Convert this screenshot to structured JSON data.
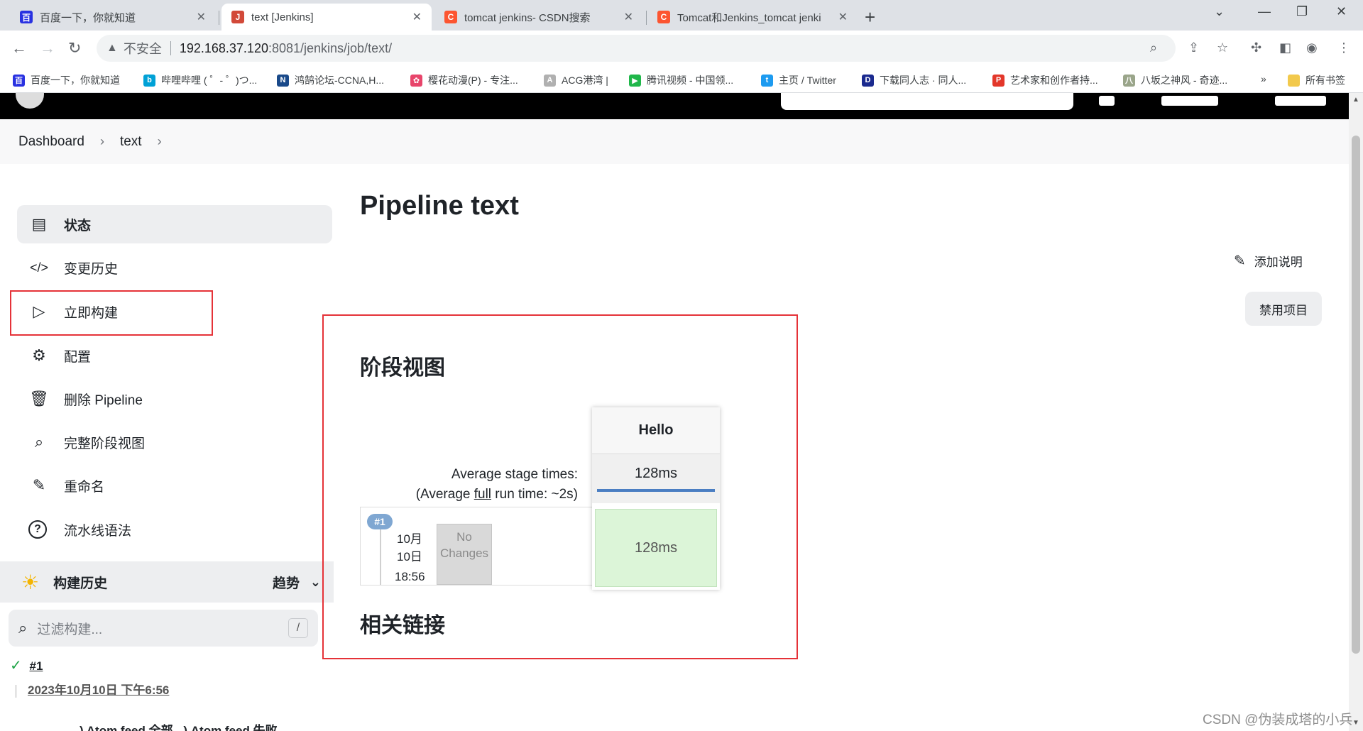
{
  "browser": {
    "tabs": [
      {
        "title": "百度一下，你就知道",
        "icon": "baidu-icon",
        "color": "#2932e1"
      },
      {
        "title": "text [Jenkins]",
        "icon": "jenkins-icon",
        "color": "#d24939"
      },
      {
        "title": "tomcat jenkins- CSDN搜索",
        "icon": "csdn-icon",
        "color": "#fc5531"
      },
      {
        "title": "Tomcat和Jenkins_tomcat jenki",
        "icon": "csdn-icon",
        "color": "#fc5531"
      }
    ],
    "url": {
      "insecure_label": "不安全",
      "host": "192.168.37.120",
      "path": ":8081/jenkins/job/text/"
    },
    "bookmarks": [
      {
        "label": "百度一下，你就知道",
        "icon": "baidu-icon",
        "color": "#2932e1"
      },
      {
        "label": "哔哩哔哩 ( ゜- ゜)つ...",
        "icon": "bilibili-icon",
        "color": "#00a1d6"
      },
      {
        "label": "鸿鹄论坛-CCNA,H...",
        "icon": "forum-icon",
        "color": "#1a4a8a"
      },
      {
        "label": "樱花动漫(P) - 专注...",
        "icon": "sakura-icon",
        "color": "#e8456b"
      },
      {
        "label": "ACG港湾 |",
        "icon": "acg-icon",
        "color": "#b0b0b0"
      },
      {
        "label": "腾讯视频 - 中国领...",
        "icon": "tencent-video-icon",
        "color": "#20b74a"
      },
      {
        "label": "主页 / Twitter",
        "icon": "twitter-icon",
        "color": "#1d9bf0"
      },
      {
        "label": "下载同人志 · 同人...",
        "icon": "dl-icon",
        "color": "#1b2a8f"
      },
      {
        "label": "艺术家和创作者持...",
        "icon": "patreon-icon",
        "color": "#e3372a"
      },
      {
        "label": "八坂之神风 - 奇迹...",
        "icon": "site-icon",
        "color": "#9aa58a"
      }
    ],
    "more_bookmarks": "»",
    "all_bookmarks": "所有书签"
  },
  "breadcrumb": {
    "items": [
      "Dashboard",
      "text"
    ]
  },
  "sidebar": {
    "items": [
      {
        "label": "状态",
        "icon": "document-icon",
        "glyph": "▤"
      },
      {
        "label": "变更历史",
        "icon": "code-icon",
        "glyph": "</>"
      },
      {
        "label": "立即构建",
        "icon": "play-icon",
        "glyph": "▷"
      },
      {
        "label": "配置",
        "icon": "gear-icon",
        "glyph": "⚙"
      },
      {
        "label": "删除 Pipeline",
        "icon": "trash-icon",
        "glyph": "🗑"
      },
      {
        "label": "完整阶段视图",
        "icon": "search-icon",
        "glyph": "⌕"
      },
      {
        "label": "重命名",
        "icon": "pencil-icon",
        "glyph": "✎"
      },
      {
        "label": "流水线语法",
        "icon": "help-icon",
        "glyph": "?"
      }
    ]
  },
  "history": {
    "title": "构建历史",
    "trend": "趋势",
    "filter_placeholder": "过滤构建...",
    "shortcut": "/",
    "builds": [
      {
        "number": "#1",
        "date": "2023年10月10日 下午6:56"
      }
    ],
    "atom_all": "Atom feed 全部",
    "atom_failed": "Atom feed 失败"
  },
  "main": {
    "title": "Pipeline text",
    "add_description": "添加说明",
    "disable": "禁用项目",
    "stage_view_title": "阶段视图",
    "avg_stage_times": "Average stage times:",
    "avg_full_prefix": "(Average ",
    "avg_full_link": "full",
    "avg_full_suffix": " run time: ~2s)",
    "stage": {
      "name": "Hello",
      "avg_time": "128ms",
      "avg_progress": 1.0
    },
    "run": {
      "badge": "#1",
      "month": "10月",
      "day": "10日",
      "time": "18:56",
      "changes_line1": "No",
      "changes_line2": "Changes",
      "stage_time": "128ms"
    },
    "related_links_title": "相关链接"
  },
  "watermark": "CSDN @伪装成塔的小兵",
  "colors": {
    "highlight_border": "#e53238",
    "success": "#1ea446",
    "stage_success": "#dcf5d8",
    "progress": "#4a7ec2"
  }
}
